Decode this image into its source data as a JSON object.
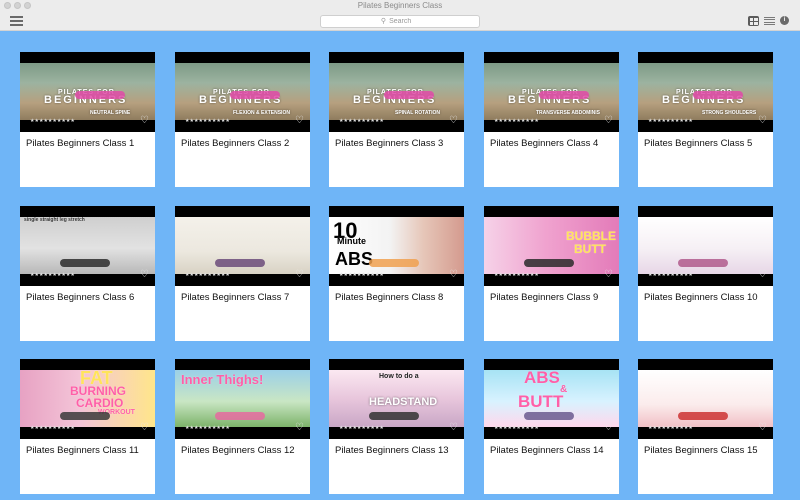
{
  "window": {
    "title": "Pilates Beginners Class"
  },
  "toolbar": {
    "search_placeholder": "Search"
  },
  "videos": [
    {
      "title": "Pilates Beginners Class 1",
      "overlay": [
        "PILATES FOR",
        "BEGINNERS",
        "NEUTRAL SPINE"
      ]
    },
    {
      "title": "Pilates Beginners Class 2",
      "overlay": [
        "PILATES FOR",
        "BEGINNERS",
        "FLEXION & EXTENSION"
      ]
    },
    {
      "title": "Pilates Beginners Class 3",
      "overlay": [
        "PILATES FOR",
        "BEGINNERS",
        "SPINAL ROTATION"
      ]
    },
    {
      "title": "Pilates Beginners Class 4",
      "overlay": [
        "PILATES FOR",
        "BEGINNERS",
        "TRANSVERSE ABDOMINIS"
      ]
    },
    {
      "title": "Pilates Beginners Class 5",
      "overlay": [
        "PILATES FOR",
        "BEGINNERS",
        "STRONG SHOULDERS"
      ]
    },
    {
      "title": "Pilates Beginners Class 6",
      "overlay": [
        "single straight leg stretch"
      ]
    },
    {
      "title": "Pilates Beginners Class 7",
      "overlay": []
    },
    {
      "title": "Pilates Beginners Class 8",
      "overlay": [
        "10",
        "Minute",
        "ABS"
      ]
    },
    {
      "title": "Pilates Beginners Class 9",
      "overlay": [
        "BUBBLE",
        "BUTT"
      ]
    },
    {
      "title": "Pilates Beginners Class 10",
      "overlay": []
    },
    {
      "title": "Pilates Beginners Class 11",
      "overlay": [
        "FAT",
        "BURNING",
        "CARDIO",
        "WORKOUT"
      ]
    },
    {
      "title": "Pilates Beginners Class 12",
      "overlay": [
        "Inner Thighs!"
      ]
    },
    {
      "title": "Pilates Beginners Class 13",
      "overlay": [
        "How to do a",
        "HEADSTAND"
      ]
    },
    {
      "title": "Pilates Beginners Class 14",
      "overlay": [
        "ABS",
        "&",
        "BUTT"
      ]
    },
    {
      "title": "Pilates Beginners Class 15",
      "overlay": []
    }
  ],
  "colors": {
    "background": "#6fb5f7",
    "card": "#ffffff"
  }
}
